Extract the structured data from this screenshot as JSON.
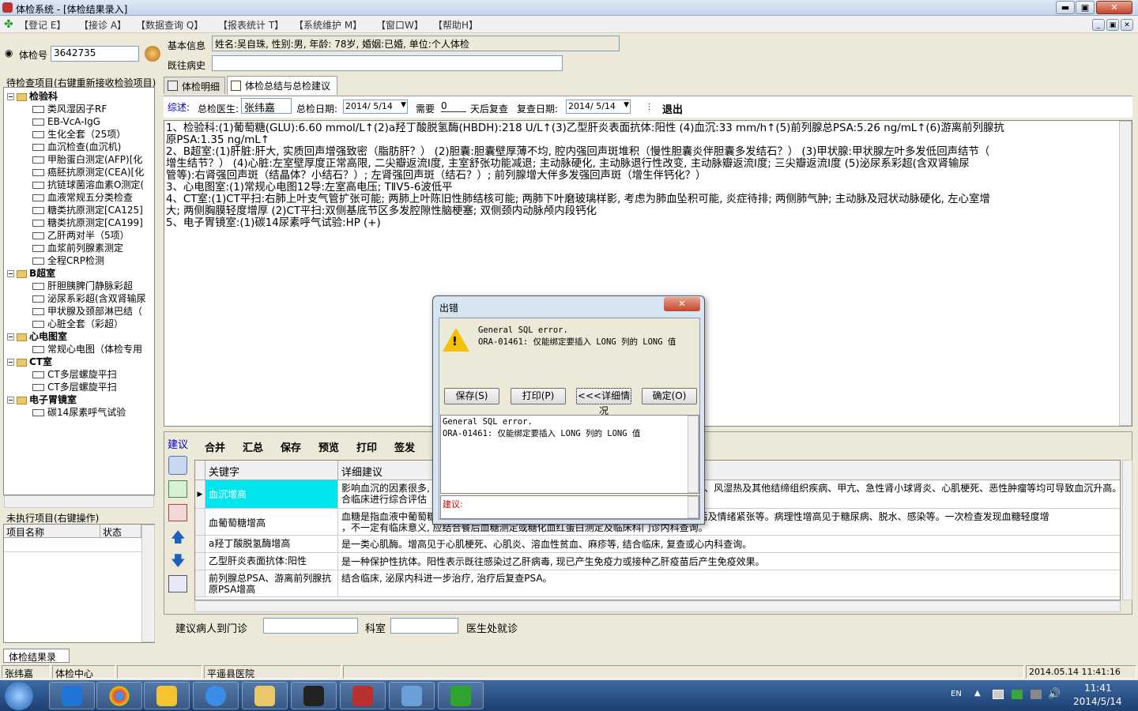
{
  "window": {
    "title": "体检系统 - [体检结果录入]",
    "min": "▬",
    "max": "▣",
    "close": "✕"
  },
  "menu": [
    "【登记 E】",
    "【接诊 A】",
    "【数据查询 Q】",
    "【报表统计 T】",
    "【系统维护 M】",
    "【窗口W】",
    "【帮助H】"
  ],
  "exam": {
    "label": "体检号",
    "value": "3642735"
  },
  "basic_info": {
    "label": "基本信息",
    "value": "姓名:吴自珠, 性别:男, 年龄: 78岁, 婚姻:已婚, 单位:个人体检"
  },
  "history": {
    "label": "既往病史",
    "value": ""
  },
  "left_panel": {
    "header": "待检查项目(右键重新接收检验项目)",
    "tree": [
      {
        "type": "cat",
        "label": "检验科"
      },
      {
        "type": "item",
        "label": "类风湿因子RF"
      },
      {
        "type": "item",
        "label": "EB-VcA-IgG"
      },
      {
        "type": "item",
        "label": "生化全套（25项）"
      },
      {
        "type": "item",
        "label": "血沉检查(血沉机)"
      },
      {
        "type": "item",
        "label": "甲胎蛋白测定(AFP)[化"
      },
      {
        "type": "item",
        "label": "癌胚抗原测定(CEA)[化"
      },
      {
        "type": "item",
        "label": "抗链球菌溶血素O测定("
      },
      {
        "type": "item",
        "label": "血液常规五分类检查"
      },
      {
        "type": "item",
        "label": "糖类抗原测定[CA125]"
      },
      {
        "type": "item",
        "label": "糖类抗原测定[CA199]"
      },
      {
        "type": "item",
        "label": "乙肝两对半（5项）"
      },
      {
        "type": "item",
        "label": "血浆前列腺素测定"
      },
      {
        "type": "item",
        "label": "全程CRP检测"
      },
      {
        "type": "cat",
        "label": "B超室"
      },
      {
        "type": "item",
        "label": "肝胆胰脾门静脉彩超"
      },
      {
        "type": "item",
        "label": "泌尿系彩超(含双肾输尿"
      },
      {
        "type": "item",
        "label": "甲状腺及颈部淋巴结（"
      },
      {
        "type": "item",
        "label": "心脏全套（彩超）"
      },
      {
        "type": "cat",
        "label": "心电图室"
      },
      {
        "type": "item",
        "label": "常规心电图（体检专用"
      },
      {
        "type": "cat",
        "label": "CT室"
      },
      {
        "type": "item",
        "label": "CT多层螺旋平扫"
      },
      {
        "type": "item",
        "label": "CT多层螺旋平扫"
      },
      {
        "type": "cat",
        "label": "电子胃镜室"
      },
      {
        "type": "item",
        "label": "碳14尿素呼气试验"
      }
    ],
    "pending_header": "未执行项目(右键操作)",
    "pending_cols": [
      "项目名称",
      "状态"
    ]
  },
  "tabs": [
    {
      "label": "体检明细"
    },
    {
      "label": "体检总结与总检建议"
    }
  ],
  "summary_bar": {
    "summary_label": "综述:",
    "doctor_label": "总检医生:",
    "doctor": "张纬嘉",
    "date_label": "总检日期:",
    "date": "2014/ 5/14",
    "need_label": "需要",
    "days": "0",
    "recheck_label": "天后复查",
    "recheck_date_label": "复查日期:",
    "recheck_date": "2014/ 5/14",
    "exit": "退出"
  },
  "results": [
    "1、检验科:(1)葡萄糖(GLU):6.60 mmol/L↑(2)a羟丁酸脱氢酶(HBDH):218 U/L↑(3)乙型肝炎表面抗体:阳性 (4)血沉:33 mm/h↑(5)前列腺总PSA:5.26 ng/mL↑(6)游离前列腺抗",
    "原PSA:1.35 ng/mL↑",
    "2、B超室:(1)肝脏:肝大, 实质回声增强致密（脂肪肝？） (2)胆囊:胆囊壁厚薄不均, 腔内强回声斑堆积（慢性胆囊炎伴胆囊多发结石？） (3)甲状腺:甲状腺左叶多发低回声结节（",
    "增生结节？） (4)心脏:左室壁厚度正常高限, 二尖瓣返流I度, 主室舒张功能减退; 主动脉硬化, 主动脉退行性改变, 主动脉瓣返流I度; 三尖瓣返流I度 (5)泌尿系彩超(含双肾输尿",
    "管等):右肾强回声斑（结晶体？小结石？）; 左肾强回声斑（结石？）; 前列腺增大伴多发强回声斑（增生伴钙化？）",
    "3、心电图室:(1)常规心电图12导:左室高电压; TⅡV5-6波低平",
    "4、CT室:(1)CT平扫:右肺上叶支气管扩张可能; 两肺上叶陈旧性肺结核可能; 两肺下叶磨玻璃样影, 考虑为肺血坠积可能, 炎症待排; 两侧肺气肿; 主动脉及冠状动脉硬化, 左心室增",
    "大; 两侧胸膜轻度增厚 (2)CT平扫:双侧基底节区多发腔隙性脑梗塞; 双侧颈内动脉颅内段钙化",
    "5、电子胃镜室:(1)碳14尿素呼气试验:HP (+)"
  ],
  "suggest": {
    "side_label": "建议",
    "toolbar": [
      "合并",
      "汇总",
      "保存",
      "预览",
      "打印",
      "签发"
    ],
    "cols": [
      "关键字",
      "详细建议"
    ],
    "rows": [
      {
        "key": "血沉增高",
        "detail": "影响血沉的因素很多, 生理性如妇女月经期、妊娠期, 病理性如各种炎症、结缔组织疾病、风湿热及其他结缔组织疾病、甲亢、急性肾小球肾炎、心肌梗死、恶性肿瘤等均可导致血沉升高。建议结",
        "detail2": "合临床进行综合评估"
      },
      {
        "key": "血葡萄糖增高",
        "detail": "血糖是指血液中葡萄糖的含量, 正常情况下保持在一定的范围内。生理性增高可见于饭后及情绪紧张等。病理性增高见于糖尿病、脱水、感染等。一次检查发现血糖轻度增",
        "detail2": "，不一定有临床意义, 应结合餐后血糖测定或糖化血红蛋白测定及临床科门诊内科查询。"
      },
      {
        "key": "a羟丁酸脱氢酶增高",
        "detail": "是一类心肌酶。增高见于心肌梗死、心肌炎、溶血性贫血、麻疹等, 结合临床, 复查或心内科查询。",
        "detail2": ""
      },
      {
        "key": "乙型肝炎表面抗体:阳性",
        "detail": "是一种保护性抗体。阳性表示既往感染过乙肝病毒, 现已产生免疫力或接种乙肝疫苗后产生免疫效果。",
        "detail2": ""
      },
      {
        "key": "前列腺总PSA、游离前列腺抗原PSA增高",
        "detail": "结合临床, 泌尿内科进一步治疗, 治疗后复查PSA。",
        "detail2": ""
      }
    ]
  },
  "bottom_form": {
    "label1": "建议病人到门诊",
    "label2": "科室",
    "label3": "医生处就诊",
    "value1": "",
    "value2": ""
  },
  "child_tab": "体检结果录入",
  "status": {
    "user": "张纬嘉",
    "center": "体检中心",
    "hospital": "平遥县医院",
    "datetime": "2014.05.14 11:41:16"
  },
  "dialog": {
    "title": "出错",
    "msg1": "General SQL error.",
    "msg2": "ORA-01461: 仅能绑定要插入 LONG 列的 LONG 值",
    "buttons": [
      "保存(S)",
      "打印(P)",
      "<<<详细情况",
      "确定(O)"
    ],
    "detail1": "General SQL error.",
    "detail2": "ORA-01461: 仅能绑定要插入 LONG 列的 LONG 值",
    "suggest_label": "建议:"
  },
  "taskbar": {
    "lang": "EN",
    "time": "11:41",
    "date": "2014/5/14",
    "apps": [
      "start",
      "mxthon",
      "chrome",
      "ie-tester",
      "ie",
      "explorer",
      "acdsee",
      "globe",
      "sql-monitor",
      "clover"
    ]
  },
  "colors": {
    "highlight": "#00e5ee",
    "accent": "#0000aa"
  }
}
